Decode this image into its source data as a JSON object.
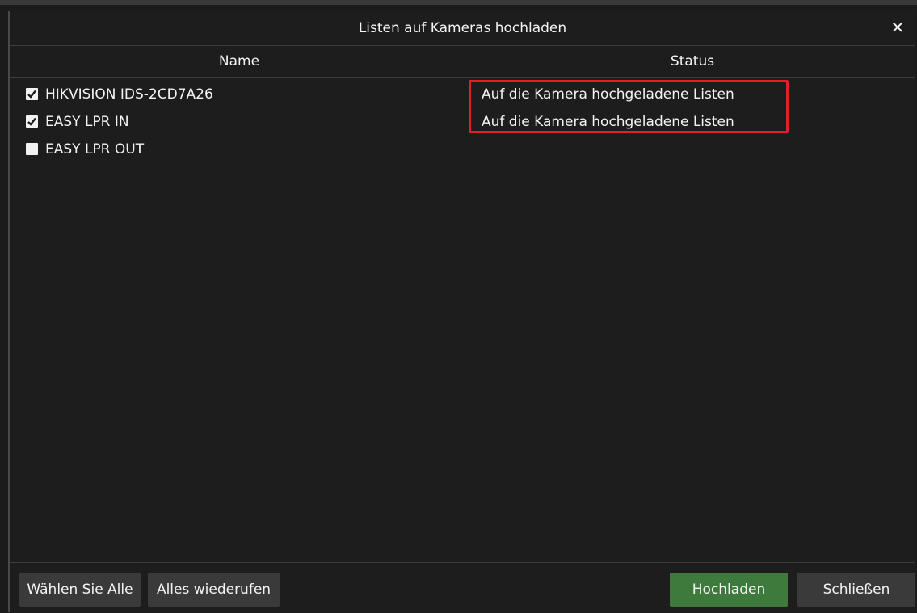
{
  "dialog": {
    "title": "Listen auf Kameras hochladen",
    "close_symbol": "✕"
  },
  "table": {
    "columns": [
      "Name",
      "Status"
    ],
    "rows": [
      {
        "name": "HIKVISION IDS-2CD7A26",
        "checked": true,
        "status": "Auf die Kamera hochgeladene Listen"
      },
      {
        "name": "EASY LPR IN",
        "checked": true,
        "status": "Auf die Kamera hochgeladene Listen"
      },
      {
        "name": "EASY LPR OUT",
        "checked": false,
        "status": ""
      }
    ]
  },
  "footer": {
    "select_all": "Wählen Sie Alle",
    "recall_all": "Alles wiederufen",
    "upload": "Hochladen",
    "close": "Schließen"
  },
  "colors": {
    "highlight": "#e0202c",
    "upload_button": "#3e7a3c",
    "background": "#1d1d1d"
  }
}
